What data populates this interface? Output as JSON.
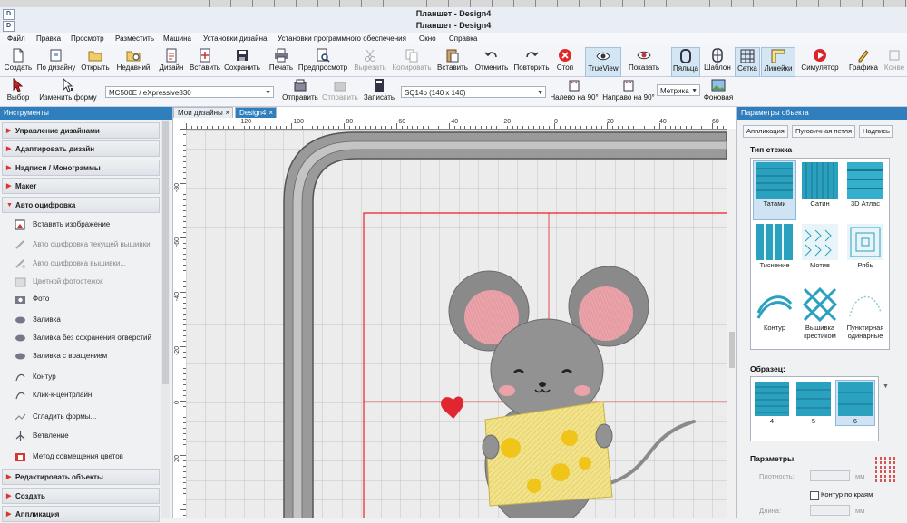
{
  "window": {
    "icon_letters": [
      "D",
      "D"
    ],
    "title_1": "Планшет - Design4",
    "title_2": "Планшет - Design4"
  },
  "menu": [
    "Файл",
    "Правка",
    "Просмотр",
    "Разместить",
    "Машина",
    "Установки дизайна",
    "Установки программного обеспечения",
    "Окно",
    "Справка"
  ],
  "toolbar": {
    "buttons": [
      {
        "label": "Создать",
        "icon": "new-file-icon"
      },
      {
        "label": "По дизайну",
        "icon": "from-design-icon"
      },
      {
        "label": "Открыть",
        "icon": "open-folder-icon"
      },
      {
        "label": "Недавний",
        "icon": "recent-icon"
      },
      {
        "label": "Дизайн",
        "icon": "design-icon"
      },
      {
        "label": "Вставить",
        "icon": "insert-icon"
      },
      {
        "label": "Сохранить",
        "icon": "save-icon"
      },
      {
        "label": "Печать",
        "icon": "print-icon"
      },
      {
        "label": "Предпросмотр",
        "icon": "preview-icon"
      },
      {
        "label": "Вырезать",
        "icon": "cut-icon"
      },
      {
        "label": "Копировать",
        "icon": "copy-icon"
      },
      {
        "label": "Вставить",
        "icon": "paste-icon"
      },
      {
        "label": "Отменить",
        "icon": "undo-icon"
      },
      {
        "label": "Повторить",
        "icon": "redo-icon"
      },
      {
        "label": "Стоп",
        "icon": "stop-icon"
      },
      {
        "label": "TrueView",
        "icon": "trueview-icon"
      },
      {
        "label": "Показать",
        "icon": "show-icon"
      },
      {
        "label": "Пяльца",
        "icon": "hoop-icon"
      },
      {
        "label": "Шаблон",
        "icon": "template-icon"
      },
      {
        "label": "Сетка",
        "icon": "grid-icon"
      },
      {
        "label": "Линейки",
        "icon": "rulers-icon"
      },
      {
        "label": "Симулятор",
        "icon": "simulator-icon"
      },
      {
        "label": "Графика",
        "icon": "graphics-icon"
      },
      {
        "label": "Конве",
        "icon": "convert-icon"
      }
    ]
  },
  "toolbar2": {
    "select_label": "Выбор",
    "reshape_label": "Изменить форму",
    "machine_combo": "MC500E / eXpressive830",
    "send_label": "Отправить",
    "send2_label": "Отправить",
    "write_label": "Записать",
    "hoop_combo": "SQ14b (140 x 140)",
    "rotate_left_label": "Налево на 90°",
    "rotate_right_label": "Направо на 90°",
    "units_combo": "Метрика",
    "background_label": "Фоновая"
  },
  "left_panel": {
    "header": "Инструменты",
    "sections_top": [
      "Управление дизайнами",
      "Адаптировать дизайн",
      "Надписи / Монограммы",
      "Макет",
      "Авто оцифровка"
    ],
    "tools": [
      {
        "label": "Вставить изображение",
        "icon": "insert-image-icon",
        "dim": false
      },
      {
        "label": "Авто оцифровка текущей вышивки",
        "icon": "auto-digitize-icon",
        "dim": true
      },
      {
        "label": "Авто оцифровка вышивки...",
        "icon": "auto-digitize-embroidery-icon",
        "dim": true
      },
      {
        "label": "Цветной фотостежок",
        "icon": "color-photostitch-icon",
        "dim": true
      },
      {
        "label": "Фото",
        "icon": "photo-icon",
        "dim": false
      },
      {
        "label": "Заливка",
        "icon": "fill-icon",
        "dim": false
      },
      {
        "label": "Заливка без сохранения отверстий",
        "icon": "fill-no-holes-icon",
        "dim": false
      },
      {
        "label": "Заливка с вращением",
        "icon": "fill-rotate-icon",
        "dim": false
      },
      {
        "label": "Контур",
        "icon": "outline-icon",
        "dim": false
      },
      {
        "label": "Клик-к-центрлайн",
        "icon": "click-centerline-icon",
        "dim": false
      },
      {
        "label": "Сгладить формы...",
        "icon": "smooth-shapes-icon",
        "dim": false
      },
      {
        "label": "Ветвление",
        "icon": "branching-icon",
        "dim": false
      },
      {
        "label": "Метод совмещения цветов",
        "icon": "color-blend-icon",
        "dim": false
      }
    ],
    "sections_bottom": [
      "Редактировать объекты",
      "Создать",
      "Аппликация"
    ]
  },
  "canvas": {
    "tabs": [
      "Мои дизайны",
      "Design4"
    ],
    "hruler_labels": [
      "-120",
      "-100",
      "-80",
      "-60",
      "-40",
      "-20",
      "0",
      "20",
      "40",
      "60"
    ],
    "vruler_labels": [
      "-80",
      "-60",
      "-40",
      "-20",
      "0",
      "20"
    ]
  },
  "right_panel": {
    "header": "Параметры объекта",
    "tabs": [
      "Аппликация",
      "Пуговичная петля",
      "Надпись"
    ],
    "stitch_type_title": "Тип стежка",
    "stitch_types": [
      {
        "label": "Татами",
        "selected": true
      },
      {
        "label": "Сатин",
        "selected": false
      },
      {
        "label": "3D Атлас",
        "selected": false
      },
      {
        "label": "Тиснение",
        "selected": false
      },
      {
        "label": "Мотив",
        "selected": false
      },
      {
        "label": "Рябь",
        "selected": false
      },
      {
        "label": "Контур",
        "selected": false
      },
      {
        "label": "Вышивка крестиком",
        "selected": false
      },
      {
        "label": "Пунктирная одинарные",
        "selected": false
      }
    ],
    "sample_title": "Образец:",
    "samples": [
      {
        "label": "4",
        "selected": false
      },
      {
        "label": "5",
        "selected": false
      },
      {
        "label": "6",
        "selected": true
      }
    ],
    "params_title": "Параметры",
    "density_label": "Плотность:",
    "edges_label": "Контур по краям",
    "length_label": "Длина:",
    "unit": "мм"
  },
  "colors": {
    "accent": "#2f7fbf",
    "guide_red": "#e8202a",
    "mouse_grey": "#8a8a8a",
    "ear_pink": "#e9a3a9",
    "cheese_yellow": "#f2e28a",
    "hole_yellow": "#f0c419",
    "heart_red": "#e22630"
  }
}
